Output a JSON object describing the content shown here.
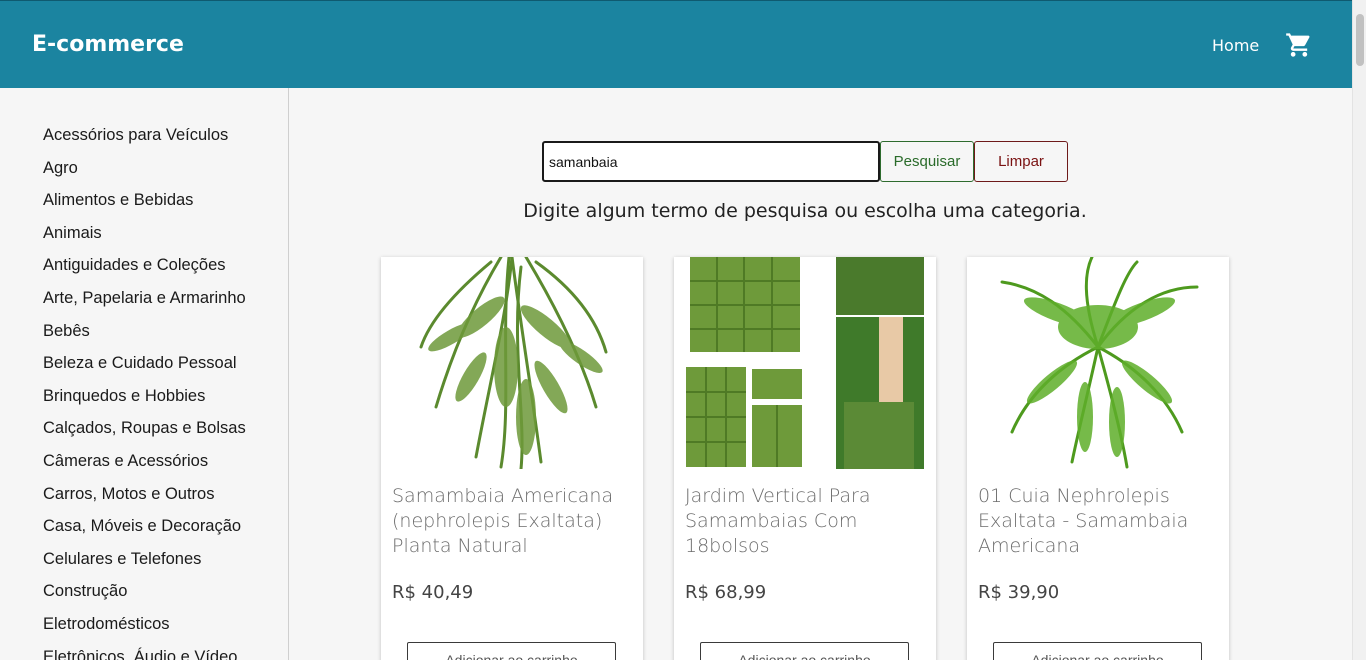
{
  "header": {
    "brand": "E-commerce",
    "nav_home": "Home",
    "cart_icon": "shopping-cart-icon",
    "bg_color": "#1b84a0"
  },
  "sidebar": {
    "categories": [
      "Acessórios para Veículos",
      "Agro",
      "Alimentos e Bebidas",
      "Animais",
      "Antiguidades e Coleções",
      "Arte, Papelaria e Armarinho",
      "Bebês",
      "Beleza e Cuidado Pessoal",
      "Brinquedos e Hobbies",
      "Calçados, Roupas e Bolsas",
      "Câmeras e Acessórios",
      "Carros, Motos e Outros",
      "Casa, Móveis e Decoração",
      "Celulares e Telefones",
      "Construção",
      "Eletrodomésticos",
      "Eletrônicos, Áudio e Vídeo"
    ]
  },
  "search": {
    "value": "samanbaia",
    "search_label": "Pesquisar",
    "clear_label": "Limpar"
  },
  "hint": "Digite algum termo de pesquisa ou escolha uma categoria.",
  "products": [
    {
      "title": "Samambaia Americana (nephrolepis Exaltata) Planta Natural",
      "price": "R$ 40,49",
      "button": "Adicionar ao carrinho"
    },
    {
      "title": "Jardim Vertical Para Samambaias Com 18bolsos",
      "price": "R$ 68,99",
      "button": "Adicionar ao carrinho"
    },
    {
      "title": "01 Cuia Nephrolepis Exaltata - Samambaia Americana",
      "price": "R$ 39,90",
      "button": "Adicionar ao carrinho"
    }
  ]
}
